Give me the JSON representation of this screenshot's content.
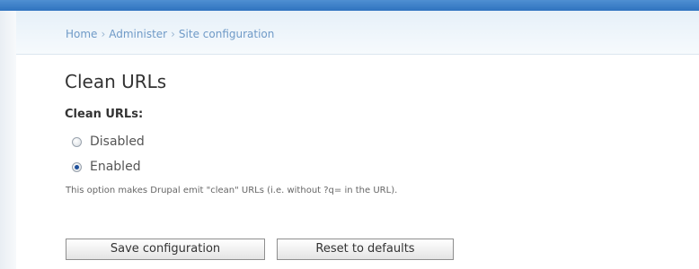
{
  "breadcrumb": {
    "items": [
      "Home",
      "Administer",
      "Site configuration"
    ],
    "separator": "›"
  },
  "page": {
    "title": "Clean URLs"
  },
  "form": {
    "field_label": "Clean URLs:",
    "options": [
      {
        "label": "Disabled",
        "selected": false
      },
      {
        "label": "Enabled",
        "selected": true
      }
    ],
    "description": "This option makes Drupal emit \"clean\" URLs (i.e. without ?q= in the URL).",
    "save_label": "Save configuration",
    "reset_label": "Reset to defaults"
  },
  "colors": {
    "top_bar": "#2f73bf",
    "breadcrumb_link": "#6f9ac7",
    "text": "#333333"
  }
}
